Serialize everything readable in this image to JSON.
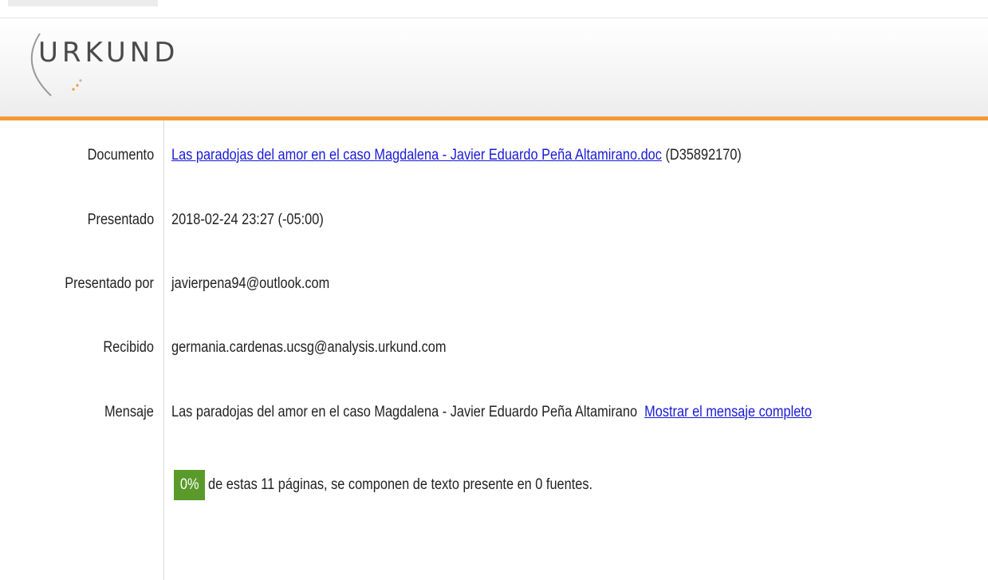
{
  "brand": {
    "logo_text": "URKUND"
  },
  "details": {
    "document": {
      "label": "Documento",
      "link_text": "Las paradojas del amor en el caso Magdalena - Javier Eduardo Peña Altamirano.doc",
      "id_text": "(D35892170)"
    },
    "submitted": {
      "label": "Presentado",
      "value": "2018-02-24 23:27 (-05:00)"
    },
    "submitted_by": {
      "label": "Presentado por",
      "value": "javierpena94@outlook.com"
    },
    "received": {
      "label": "Recibido",
      "value": "germania.cardenas.ucsg@analysis.urkund.com"
    },
    "message": {
      "label": "Mensaje",
      "value": "Las paradojas del amor en el caso Magdalena - Javier Eduardo Peña Altamirano",
      "link_text": "Mostrar el mensaje completo"
    }
  },
  "summary": {
    "percent_badge": "0%",
    "text": "de estas 11 páginas, se componen de texto presente en 0 fuentes."
  },
  "colors": {
    "accent_orange": "#f29a36",
    "badge_green": "#5a9a2a",
    "link_blue": "#1a1ad8"
  }
}
